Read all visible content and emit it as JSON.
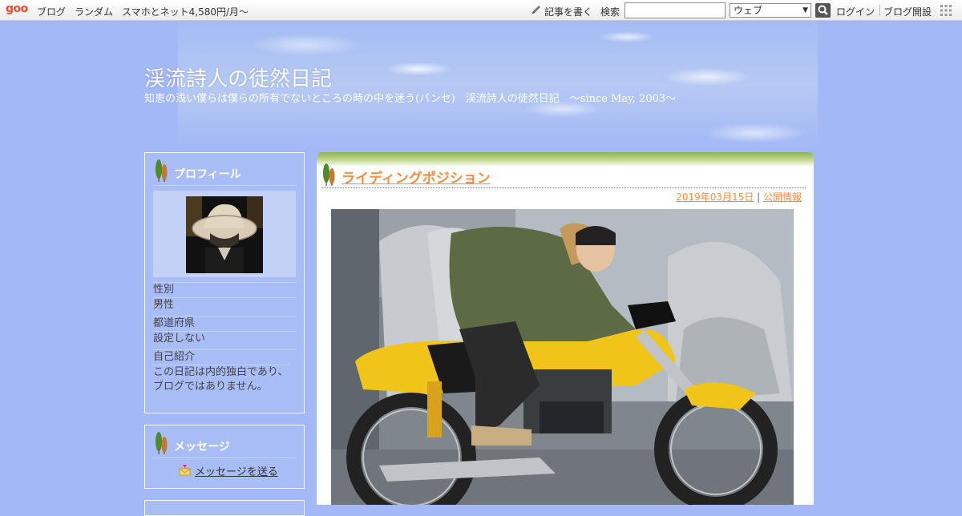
{
  "topbar": {
    "logo": "goo",
    "links": [
      "ブログ",
      "ランダム",
      "スマホとネット4,580円/月～"
    ],
    "write_label": "記事を書く",
    "search_label": "検索",
    "search_value": "",
    "search_scope": "ウェブ",
    "login_label": "ログイン",
    "open_blog_label": "ブログ開設"
  },
  "header": {
    "title": "渓流詩人の徒然日記",
    "subtitle": "知恵の浅い僕らは僕らの所有でないところの時の中を迷う(パンセ)　渓流詩人の徒然日記　～since May, 2003～"
  },
  "sidebar": {
    "profile": {
      "heading": "プロフィール",
      "fields": [
        {
          "label": "性別",
          "value": "男性"
        },
        {
          "label": "都道府県",
          "value": "設定しない"
        },
        {
          "label": "自己紹介",
          "value": "この日記は内的独白であり、ブログではありません。"
        }
      ]
    },
    "message": {
      "heading": "メッセージ",
      "link": "メッセージを送る"
    }
  },
  "entry": {
    "title": "ライディングポジション",
    "date": "2019年03月15日",
    "separator": "|",
    "visibility": "公開情報"
  },
  "colors": {
    "page_bg": "#a3b8f6",
    "title_orange": "#ff8a3d",
    "green_band": "#8ab350"
  }
}
